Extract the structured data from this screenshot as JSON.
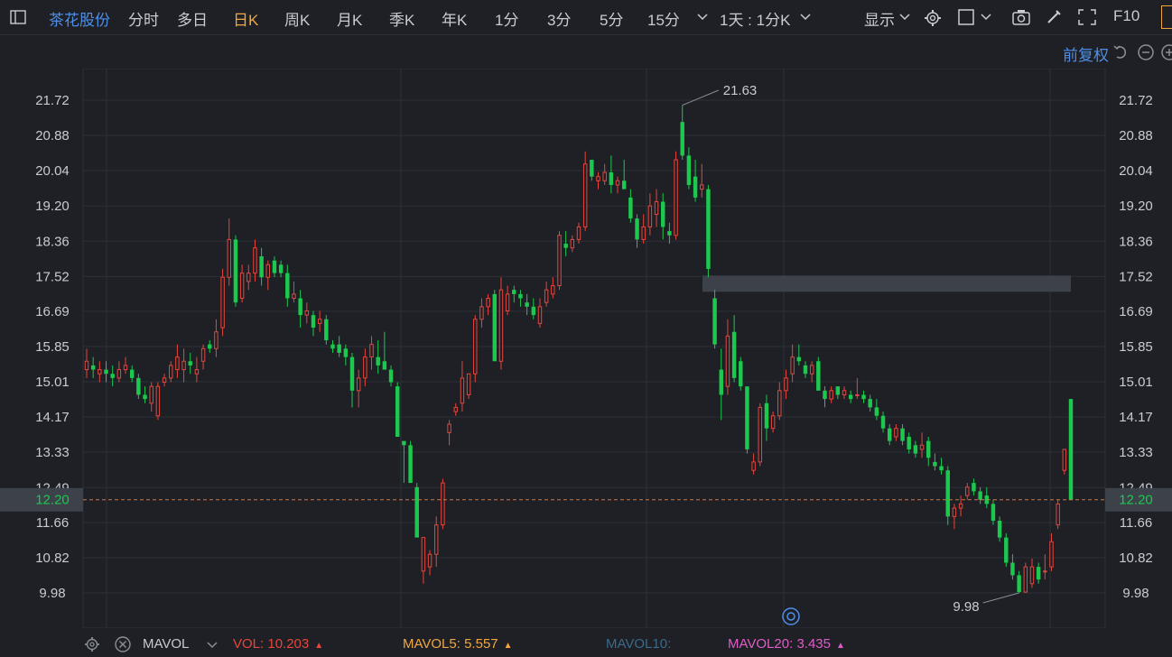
{
  "toolbar": {
    "stock_name": "茶花股份",
    "tabs": [
      "分时",
      "多日",
      "日K",
      "周K",
      "月K",
      "季K",
      "年K",
      "1分",
      "3分",
      "5分",
      "15分"
    ],
    "active_tab": "日K",
    "period_select": "1天 : 1分K",
    "display_label": "显示",
    "f10_label": "F10"
  },
  "adjust_label": "前复权",
  "chart_data": {
    "type": "candlestick",
    "y_ticks": [
      "21.72",
      "20.88",
      "20.04",
      "19.20",
      "18.36",
      "17.52",
      "16.69",
      "15.85",
      "15.01",
      "14.17",
      "13.33",
      "12.49",
      "11.66",
      "10.82",
      "9.98"
    ],
    "current_price": "12.20",
    "high_label": "21.63",
    "low_label": "9.98",
    "up_color": "#e8453c",
    "down_color": "#1dc84f",
    "candles": [
      {
        "o": 15.3,
        "h": 15.8,
        "l": 15.1,
        "c": 15.5
      },
      {
        "o": 15.4,
        "h": 15.6,
        "l": 15.1,
        "c": 15.3
      },
      {
        "o": 15.2,
        "h": 15.5,
        "l": 15.0,
        "c": 15.3
      },
      {
        "o": 15.3,
        "h": 15.5,
        "l": 15.0,
        "c": 15.2
      },
      {
        "o": 15.2,
        "h": 15.4,
        "l": 14.9,
        "c": 15.1
      },
      {
        "o": 15.1,
        "h": 15.5,
        "l": 15.0,
        "c": 15.3
      },
      {
        "o": 15.3,
        "h": 15.6,
        "l": 15.2,
        "c": 15.4
      },
      {
        "o": 15.3,
        "h": 15.4,
        "l": 15.0,
        "c": 15.1
      },
      {
        "o": 15.1,
        "h": 15.2,
        "l": 14.6,
        "c": 14.7
      },
      {
        "o": 14.7,
        "h": 14.9,
        "l": 14.5,
        "c": 14.6
      },
      {
        "o": 14.5,
        "h": 15.0,
        "l": 14.3,
        "c": 14.9
      },
      {
        "o": 14.2,
        "h": 15.0,
        "l": 14.1,
        "c": 14.9
      },
      {
        "o": 15.0,
        "h": 15.2,
        "l": 14.9,
        "c": 15.1
      },
      {
        "o": 15.1,
        "h": 15.5,
        "l": 15.0,
        "c": 15.4
      },
      {
        "o": 15.3,
        "h": 15.9,
        "l": 15.1,
        "c": 15.6
      },
      {
        "o": 15.3,
        "h": 15.8,
        "l": 15.0,
        "c": 15.5
      },
      {
        "o": 15.5,
        "h": 15.7,
        "l": 15.2,
        "c": 15.4
      },
      {
        "o": 15.2,
        "h": 15.6,
        "l": 15.0,
        "c": 15.3
      },
      {
        "o": 15.5,
        "h": 15.9,
        "l": 15.3,
        "c": 15.8
      },
      {
        "o": 15.9,
        "h": 16.0,
        "l": 15.7,
        "c": 15.8
      },
      {
        "o": 15.8,
        "h": 16.5,
        "l": 15.6,
        "c": 16.2
      },
      {
        "o": 16.3,
        "h": 17.7,
        "l": 16.1,
        "c": 17.5
      },
      {
        "o": 17.5,
        "h": 18.9,
        "l": 17.3,
        "c": 18.4
      },
      {
        "o": 18.4,
        "h": 18.5,
        "l": 16.8,
        "c": 16.9
      },
      {
        "o": 17.0,
        "h": 17.8,
        "l": 16.9,
        "c": 17.6
      },
      {
        "o": 17.4,
        "h": 17.8,
        "l": 17.2,
        "c": 17.6
      },
      {
        "o": 17.6,
        "h": 18.4,
        "l": 17.4,
        "c": 18.2
      },
      {
        "o": 18.0,
        "h": 18.2,
        "l": 17.3,
        "c": 17.5
      },
      {
        "o": 17.5,
        "h": 17.9,
        "l": 17.2,
        "c": 17.8
      },
      {
        "o": 17.9,
        "h": 18.0,
        "l": 17.5,
        "c": 17.6
      },
      {
        "o": 17.8,
        "h": 17.9,
        "l": 17.5,
        "c": 17.6
      },
      {
        "o": 17.6,
        "h": 17.8,
        "l": 16.8,
        "c": 17.0
      },
      {
        "o": 17.0,
        "h": 17.4,
        "l": 16.9,
        "c": 17.1
      },
      {
        "o": 17.0,
        "h": 17.2,
        "l": 16.3,
        "c": 16.6
      },
      {
        "o": 16.6,
        "h": 16.9,
        "l": 16.4,
        "c": 16.7
      },
      {
        "o": 16.6,
        "h": 16.7,
        "l": 16.1,
        "c": 16.3
      },
      {
        "o": 16.4,
        "h": 16.7,
        "l": 16.2,
        "c": 16.5
      },
      {
        "o": 16.5,
        "h": 16.6,
        "l": 15.9,
        "c": 16.0
      },
      {
        "o": 15.9,
        "h": 16.0,
        "l": 15.7,
        "c": 15.8
      },
      {
        "o": 15.9,
        "h": 16.1,
        "l": 15.6,
        "c": 15.7
      },
      {
        "o": 15.8,
        "h": 15.9,
        "l": 15.4,
        "c": 15.6
      },
      {
        "o": 15.6,
        "h": 15.7,
        "l": 14.4,
        "c": 14.8
      },
      {
        "o": 14.8,
        "h": 15.3,
        "l": 14.4,
        "c": 15.1
      },
      {
        "o": 15.1,
        "h": 15.8,
        "l": 14.9,
        "c": 15.6
      },
      {
        "o": 15.6,
        "h": 16.1,
        "l": 15.3,
        "c": 15.9
      },
      {
        "o": 15.6,
        "h": 16.0,
        "l": 15.2,
        "c": 15.4
      },
      {
        "o": 15.5,
        "h": 16.2,
        "l": 15.3,
        "c": 15.3
      },
      {
        "o": 15.3,
        "h": 15.4,
        "l": 14.9,
        "c": 15.0
      },
      {
        "o": 14.9,
        "h": 15.0,
        "l": 14.0,
        "c": 13.7
      },
      {
        "o": 13.6,
        "h": 13.6,
        "l": 12.6,
        "c": 13.5
      },
      {
        "o": 13.5,
        "h": 13.6,
        "l": 12.7,
        "c": 12.6
      },
      {
        "o": 12.5,
        "h": 12.6,
        "l": 11.4,
        "c": 11.3
      },
      {
        "o": 10.5,
        "h": 11.3,
        "l": 10.2,
        "c": 11.3
      },
      {
        "o": 10.6,
        "h": 11.0,
        "l": 10.4,
        "c": 10.9
      },
      {
        "o": 10.9,
        "h": 11.8,
        "l": 10.6,
        "c": 11.6
      },
      {
        "o": 11.6,
        "h": 12.7,
        "l": 11.5,
        "c": 12.6
      },
      {
        "o": 13.8,
        "h": 14.1,
        "l": 13.5,
        "c": 14.0
      },
      {
        "o": 14.3,
        "h": 14.5,
        "l": 14.2,
        "c": 14.4
      },
      {
        "o": 14.5,
        "h": 15.5,
        "l": 14.3,
        "c": 15.1
      },
      {
        "o": 14.7,
        "h": 15.2,
        "l": 14.6,
        "c": 15.2
      },
      {
        "o": 15.2,
        "h": 16.6,
        "l": 15.0,
        "c": 16.5
      },
      {
        "o": 16.5,
        "h": 17.0,
        "l": 16.3,
        "c": 16.8
      },
      {
        "o": 16.8,
        "h": 17.1,
        "l": 16.6,
        "c": 17.0
      },
      {
        "o": 17.1,
        "h": 17.2,
        "l": 16.1,
        "c": 15.5
      },
      {
        "o": 15.5,
        "h": 17.5,
        "l": 15.3,
        "c": 17.2
      },
      {
        "o": 16.7,
        "h": 17.3,
        "l": 16.6,
        "c": 17.1
      },
      {
        "o": 17.2,
        "h": 17.3,
        "l": 16.9,
        "c": 17.1
      },
      {
        "o": 17.1,
        "h": 17.2,
        "l": 16.8,
        "c": 17.0
      },
      {
        "o": 16.9,
        "h": 17.1,
        "l": 16.6,
        "c": 16.8
      },
      {
        "o": 16.8,
        "h": 17.0,
        "l": 16.5,
        "c": 16.6
      },
      {
        "o": 16.4,
        "h": 17.0,
        "l": 16.3,
        "c": 16.8
      },
      {
        "o": 16.9,
        "h": 17.4,
        "l": 16.8,
        "c": 17.2
      },
      {
        "o": 17.1,
        "h": 17.5,
        "l": 17.0,
        "c": 17.3
      },
      {
        "o": 17.3,
        "h": 18.6,
        "l": 17.2,
        "c": 18.5
      },
      {
        "o": 18.3,
        "h": 18.6,
        "l": 18.0,
        "c": 18.2
      },
      {
        "o": 18.2,
        "h": 18.5,
        "l": 18.1,
        "c": 18.4
      },
      {
        "o": 18.4,
        "h": 18.8,
        "l": 18.3,
        "c": 18.7
      },
      {
        "o": 18.7,
        "h": 20.5,
        "l": 18.6,
        "c": 20.2
      },
      {
        "o": 20.3,
        "h": 20.3,
        "l": 19.8,
        "c": 19.9
      },
      {
        "o": 19.8,
        "h": 20.0,
        "l": 19.6,
        "c": 19.9
      },
      {
        "o": 19.8,
        "h": 20.2,
        "l": 19.7,
        "c": 20.0
      },
      {
        "o": 20.0,
        "h": 20.4,
        "l": 19.5,
        "c": 19.7
      },
      {
        "o": 19.7,
        "h": 19.9,
        "l": 19.5,
        "c": 19.8
      },
      {
        "o": 19.8,
        "h": 20.3,
        "l": 19.6,
        "c": 19.6
      },
      {
        "o": 19.4,
        "h": 19.6,
        "l": 18.8,
        "c": 18.9
      },
      {
        "o": 18.9,
        "h": 19.0,
        "l": 18.2,
        "c": 18.4
      },
      {
        "o": 18.4,
        "h": 19.0,
        "l": 18.3,
        "c": 18.7
      },
      {
        "o": 18.7,
        "h": 19.5,
        "l": 18.5,
        "c": 19.2
      },
      {
        "o": 19.0,
        "h": 19.6,
        "l": 18.7,
        "c": 19.3
      },
      {
        "o": 19.3,
        "h": 19.5,
        "l": 18.4,
        "c": 18.7
      },
      {
        "o": 18.6,
        "h": 18.8,
        "l": 18.3,
        "c": 18.5
      },
      {
        "o": 18.5,
        "h": 20.5,
        "l": 18.4,
        "c": 20.3
      },
      {
        "o": 21.2,
        "h": 21.6,
        "l": 20.3,
        "c": 20.4
      },
      {
        "o": 20.4,
        "h": 20.6,
        "l": 19.6,
        "c": 19.7
      },
      {
        "o": 19.9,
        "h": 20.3,
        "l": 19.3,
        "c": 19.4
      },
      {
        "o": 19.6,
        "h": 20.2,
        "l": 19.4,
        "c": 19.7
      },
      {
        "o": 19.6,
        "h": 19.7,
        "l": 17.5,
        "c": 17.7
      },
      {
        "o": 17.0,
        "h": 17.2,
        "l": 15.8,
        "c": 15.9
      },
      {
        "o": 15.3,
        "h": 15.8,
        "l": 14.1,
        "c": 14.7
      },
      {
        "o": 14.9,
        "h": 16.5,
        "l": 14.7,
        "c": 16.1
      },
      {
        "o": 16.2,
        "h": 16.6,
        "l": 15.0,
        "c": 15.1
      },
      {
        "o": 15.5,
        "h": 15.6,
        "l": 14.8,
        "c": 14.9
      },
      {
        "o": 14.9,
        "h": 14.9,
        "l": 13.3,
        "c": 13.4
      },
      {
        "o": 12.9,
        "h": 13.3,
        "l": 12.8,
        "c": 13.1
      },
      {
        "o": 13.1,
        "h": 14.5,
        "l": 13.0,
        "c": 14.4
      },
      {
        "o": 14.5,
        "h": 14.7,
        "l": 13.6,
        "c": 13.9
      },
      {
        "o": 13.9,
        "h": 14.3,
        "l": 13.8,
        "c": 14.2
      },
      {
        "o": 14.2,
        "h": 15.0,
        "l": 14.1,
        "c": 14.8
      },
      {
        "o": 14.8,
        "h": 15.3,
        "l": 14.6,
        "c": 15.1
      },
      {
        "o": 15.2,
        "h": 15.9,
        "l": 15.0,
        "c": 15.6
      },
      {
        "o": 15.6,
        "h": 15.9,
        "l": 15.4,
        "c": 15.5
      },
      {
        "o": 15.4,
        "h": 15.5,
        "l": 15.1,
        "c": 15.2
      },
      {
        "o": 15.2,
        "h": 15.5,
        "l": 15.0,
        "c": 15.4
      },
      {
        "o": 15.5,
        "h": 15.6,
        "l": 14.8,
        "c": 14.8
      },
      {
        "o": 14.8,
        "h": 14.9,
        "l": 14.4,
        "c": 14.6
      },
      {
        "o": 14.6,
        "h": 14.9,
        "l": 14.5,
        "c": 14.8
      },
      {
        "o": 14.9,
        "h": 14.9,
        "l": 14.6,
        "c": 14.7
      },
      {
        "o": 14.7,
        "h": 14.9,
        "l": 14.6,
        "c": 14.8
      },
      {
        "o": 14.7,
        "h": 14.8,
        "l": 14.5,
        "c": 14.6
      },
      {
        "o": 14.7,
        "h": 15.1,
        "l": 14.6,
        "c": 14.7
      },
      {
        "o": 14.7,
        "h": 14.8,
        "l": 14.5,
        "c": 14.6
      },
      {
        "o": 14.6,
        "h": 14.7,
        "l": 14.3,
        "c": 14.4
      },
      {
        "o": 14.4,
        "h": 14.6,
        "l": 14.1,
        "c": 14.2
      },
      {
        "o": 14.2,
        "h": 14.3,
        "l": 13.8,
        "c": 13.9
      },
      {
        "o": 13.9,
        "h": 14.0,
        "l": 13.5,
        "c": 13.6
      },
      {
        "o": 13.7,
        "h": 14.0,
        "l": 13.6,
        "c": 13.9
      },
      {
        "o": 13.9,
        "h": 14.0,
        "l": 13.5,
        "c": 13.6
      },
      {
        "o": 13.7,
        "h": 13.8,
        "l": 13.3,
        "c": 13.4
      },
      {
        "o": 13.5,
        "h": 13.6,
        "l": 13.2,
        "c": 13.3
      },
      {
        "o": 13.4,
        "h": 13.8,
        "l": 13.2,
        "c": 13.5
      },
      {
        "o": 13.6,
        "h": 13.7,
        "l": 13.0,
        "c": 13.2
      },
      {
        "o": 13.1,
        "h": 13.3,
        "l": 12.9,
        "c": 13.0
      },
      {
        "o": 13.0,
        "h": 13.2,
        "l": 12.8,
        "c": 12.9
      },
      {
        "o": 12.9,
        "h": 13.0,
        "l": 11.6,
        "c": 11.8
      },
      {
        "o": 11.8,
        "h": 12.1,
        "l": 11.5,
        "c": 12.0
      },
      {
        "o": 12.0,
        "h": 12.3,
        "l": 11.8,
        "c": 12.1
      },
      {
        "o": 12.3,
        "h": 12.6,
        "l": 12.2,
        "c": 12.5
      },
      {
        "o": 12.6,
        "h": 12.7,
        "l": 12.3,
        "c": 12.4
      },
      {
        "o": 12.4,
        "h": 12.5,
        "l": 12.1,
        "c": 12.2
      },
      {
        "o": 12.3,
        "h": 12.5,
        "l": 12.0,
        "c": 12.1
      },
      {
        "o": 12.1,
        "h": 12.2,
        "l": 11.6,
        "c": 11.7
      },
      {
        "o": 11.7,
        "h": 11.8,
        "l": 11.2,
        "c": 11.3
      },
      {
        "o": 11.3,
        "h": 11.4,
        "l": 10.6,
        "c": 10.7
      },
      {
        "o": 10.7,
        "h": 10.9,
        "l": 10.3,
        "c": 10.4
      },
      {
        "o": 10.4,
        "h": 10.5,
        "l": 9.98,
        "c": 10.0
      },
      {
        "o": 10.0,
        "h": 10.7,
        "l": 9.98,
        "c": 10.6
      },
      {
        "o": 10.2,
        "h": 10.8,
        "l": 10.1,
        "c": 10.6
      },
      {
        "o": 10.6,
        "h": 10.7,
        "l": 10.2,
        "c": 10.3
      },
      {
        "o": 10.5,
        "h": 10.9,
        "l": 10.3,
        "c": 10.5
      },
      {
        "o": 10.6,
        "h": 11.4,
        "l": 10.5,
        "c": 11.2
      },
      {
        "o": 11.6,
        "h": 12.2,
        "l": 11.5,
        "c": 12.1
      },
      {
        "o": 12.9,
        "h": 13.4,
        "l": 12.8,
        "c": 13.4
      },
      {
        "o": 14.6,
        "h": 14.6,
        "l": 12.2,
        "c": 12.2
      }
    ]
  },
  "footer": {
    "indicator": "MAVOL",
    "vol_label": "VOL:",
    "vol_value": "10.203",
    "mavol5_label": "MAVOL5:",
    "mavol5_value": "5.557",
    "mavol10_label": "MAVOL10:",
    "mavol20_label": "MAVOL20:",
    "mavol20_value": "3.435",
    "colors": {
      "vol": "#e8453c",
      "mavol5": "#f0a742",
      "mavol10": "#3a6b8a",
      "mavol20": "#e05cc8"
    }
  }
}
